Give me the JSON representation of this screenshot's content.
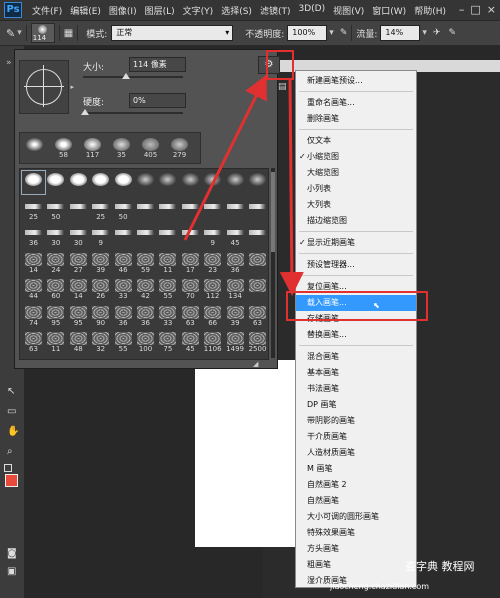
{
  "app": {
    "logo": "Ps"
  },
  "menubar": {
    "items": [
      "文件(F)",
      "编辑(E)",
      "图像(I)",
      "图层(L)",
      "文字(Y)",
      "选择(S)",
      "滤镜(T)",
      "3D(D)",
      "视图(V)",
      "窗口(W)",
      "帮助(H)"
    ]
  },
  "options_bar": {
    "brush_size": "114",
    "mode_label": "模式:",
    "mode_value": "正常",
    "opacity_label": "不透明度:",
    "opacity_value": "100%",
    "flow_label": "流量:",
    "flow_value": "14%"
  },
  "brush_panel": {
    "size_label": "大小:",
    "size_value": "114 像素",
    "hardness_label": "硬度:",
    "hardness_value": "0%",
    "recent_numbers": [
      "58",
      "117",
      "35",
      "405",
      "279"
    ],
    "grid_numbers": [
      [
        "",
        "",
        "",
        "",
        "",
        "",
        "",
        "",
        "",
        "",
        ""
      ],
      [
        "25",
        "50",
        "",
        "25",
        "50",
        "",
        "",
        "",
        "",
        "",
        ""
      ],
      [
        "36",
        "30",
        "30",
        "9",
        "",
        "",
        "",
        "",
        "9",
        "45",
        ""
      ],
      [
        "14",
        "24",
        "27",
        "39",
        "46",
        "59",
        "11",
        "17",
        "23",
        "36",
        ""
      ],
      [
        "44",
        "60",
        "14",
        "26",
        "33",
        "42",
        "55",
        "70",
        "112",
        "134",
        ""
      ],
      [
        "74",
        "95",
        "95",
        "90",
        "36",
        "36",
        "33",
        "63",
        "66",
        "39",
        "63"
      ],
      [
        "63",
        "11",
        "48",
        "32",
        "55",
        "100",
        "75",
        "45",
        "1106",
        "1499",
        "2500"
      ]
    ]
  },
  "dropdown_menu": {
    "items": [
      {
        "label": "新建画笔预设...",
        "checked": false
      },
      {
        "label": "重命名画笔...",
        "checked": false
      },
      {
        "label": "删除画笔",
        "checked": false
      },
      {
        "label": "仅文本",
        "checked": false
      },
      {
        "label": "小缩览图",
        "checked": true
      },
      {
        "label": "大缩览图",
        "checked": false
      },
      {
        "label": "小列表",
        "checked": false
      },
      {
        "label": "大列表",
        "checked": false
      },
      {
        "label": "描边缩览图",
        "checked": false
      },
      {
        "label": "显示近期画笔",
        "checked": true
      },
      {
        "label": "预设管理器...",
        "checked": false
      },
      {
        "label": "复位画笔...",
        "checked": false
      },
      {
        "label": "载入画笔...",
        "checked": false,
        "highlighted": true
      },
      {
        "label": "存储画笔...",
        "checked": false
      },
      {
        "label": "替换画笔...",
        "checked": false
      },
      {
        "label": "混合画笔",
        "checked": false
      },
      {
        "label": "基本画笔",
        "checked": false
      },
      {
        "label": "书法画笔",
        "checked": false
      },
      {
        "label": "DP 画笔",
        "checked": false
      },
      {
        "label": "带阴影的画笔",
        "checked": false
      },
      {
        "label": "干介质画笔",
        "checked": false
      },
      {
        "label": "人造材质画笔",
        "checked": false
      },
      {
        "label": "M 画笔",
        "checked": false
      },
      {
        "label": "自然画笔 2",
        "checked": false
      },
      {
        "label": "自然画笔",
        "checked": false
      },
      {
        "label": "大小可调的圆形画笔",
        "checked": false
      },
      {
        "label": "特殊效果画笔",
        "checked": false
      },
      {
        "label": "方头画笔",
        "checked": false
      },
      {
        "label": "粗画笔",
        "checked": false
      },
      {
        "label": "湿介质画笔",
        "checked": false
      }
    ]
  },
  "colors": {
    "foreground": "#e84a3b",
    "background": "#111111",
    "highlight": "#3399ff",
    "annotation_red": "#e03030"
  },
  "watermark": {
    "site": "jiaocheng.chazidian.com",
    "brand": "查字典 教程网"
  }
}
